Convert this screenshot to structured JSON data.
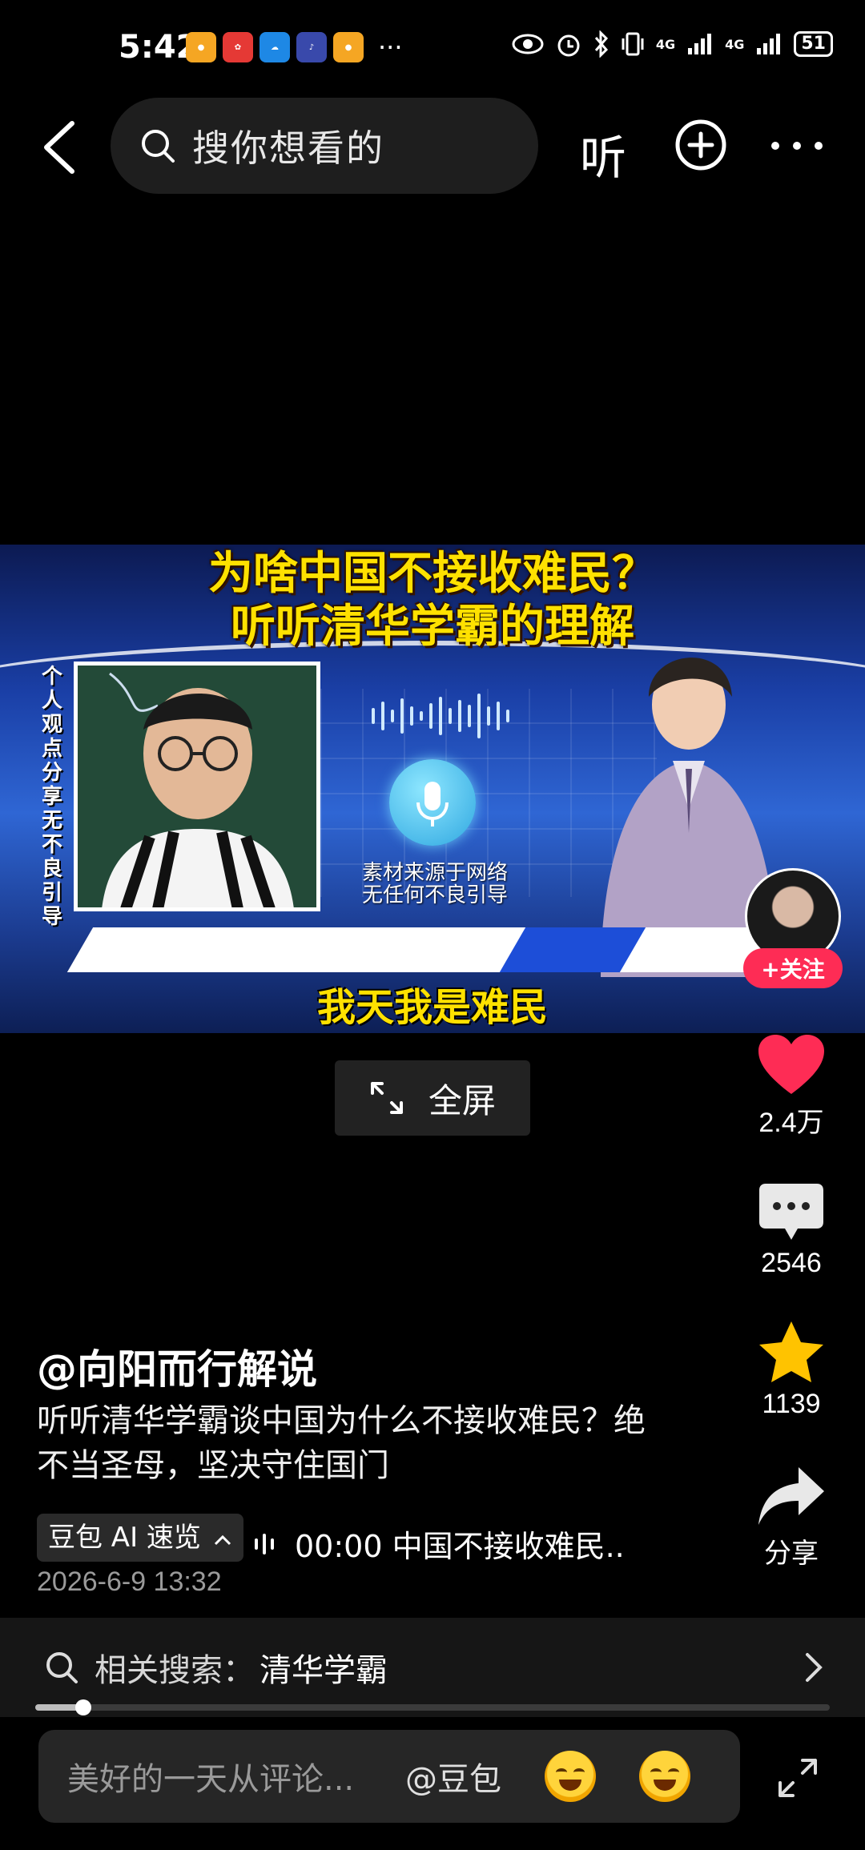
{
  "status_bar": {
    "time": "5:42",
    "apps": [
      {
        "icon": "weibo-icon",
        "color": "#f5a623"
      },
      {
        "icon": "huawei-icon",
        "color": "#e53935"
      },
      {
        "icon": "weather-icon",
        "color": "#1e88e5"
      },
      {
        "icon": "music-icon",
        "color": "#3949ab"
      },
      {
        "icon": "weibo-icon",
        "color": "#f5a623"
      }
    ],
    "more": "···",
    "network_1": "4G",
    "network_2": "4G",
    "battery": "51"
  },
  "nav": {
    "search_placeholder": "搜你想看的",
    "listen_label": "听"
  },
  "video": {
    "title_line1": "为啥中国不接收难民？",
    "title_line2": "听听清华学霸的理解",
    "side_text": "个人观点分享 无不良引导",
    "material_note_line1": "素材来源于网络",
    "material_note_line2": "无任何不良引导",
    "subtitle": "我天我是难民",
    "follow_label": "+关注"
  },
  "fullscreen": {
    "label": "全屏"
  },
  "actions": {
    "likes": "2.4万",
    "comments": "2546",
    "favorites": "1139",
    "share": "分享"
  },
  "post": {
    "author": "@向阳而行解说",
    "description": "听听清华学霸谈中国为什么不接收难民？绝不当圣母，坚决守住国门",
    "ai_chip": "豆包 AI 速览",
    "ai_audio": "00:00 中国不接收难民..",
    "date": "2026-6-9 13:32"
  },
  "related": {
    "prefix": "相关搜索：",
    "term": "清华学霸"
  },
  "progress": {
    "played_fraction": 0.06
  },
  "comment_bar": {
    "placeholder": "美好的一天从评论...",
    "mention": "@豆包"
  },
  "colors": {
    "like": "#fe2c55",
    "favorite": "#ffc300",
    "follow": "#fe2c55",
    "title_yellow": "#ffe100"
  }
}
